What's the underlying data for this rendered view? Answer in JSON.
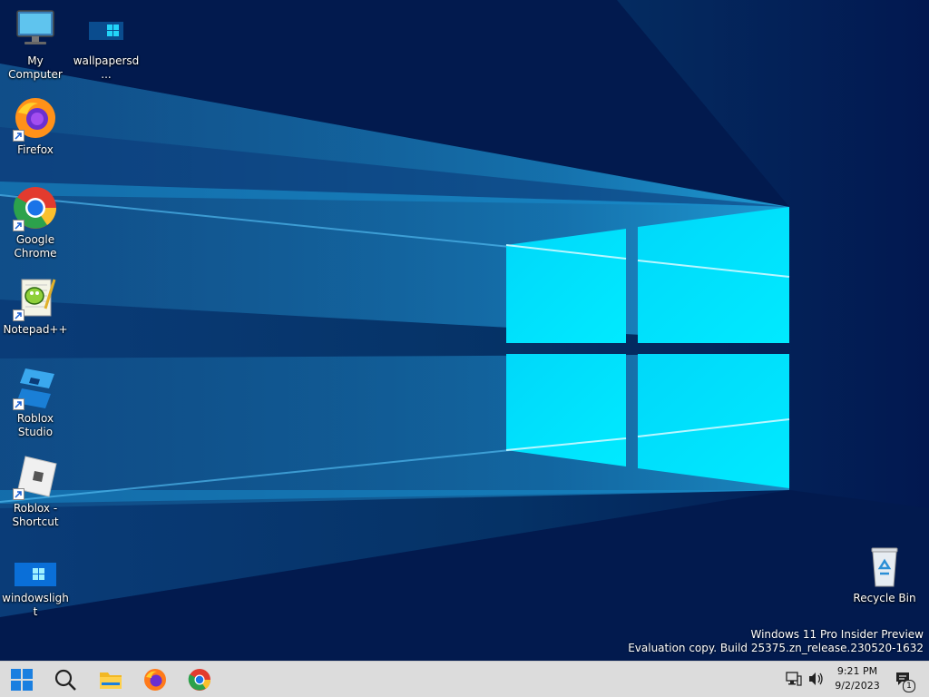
{
  "desktop": {
    "icons": [
      {
        "label": "My Computer",
        "icon": "monitor-icon"
      },
      {
        "label": "wallpapersd...",
        "icon": "image-file-icon"
      },
      {
        "label": "Firefox",
        "icon": "firefox-icon"
      },
      {
        "label": "Google Chrome",
        "icon": "chrome-icon"
      },
      {
        "label": "Notepad++",
        "icon": "notepadpp-icon"
      },
      {
        "label": "Roblox Studio",
        "icon": "roblox-studio-icon"
      },
      {
        "label": "Roblox - Shortcut",
        "icon": "roblox-icon"
      },
      {
        "label": "windowslight",
        "icon": "image-file-icon"
      },
      {
        "label": "Recycle Bin",
        "icon": "recycle-bin-icon"
      }
    ]
  },
  "watermark": {
    "line1": "Windows 11 Pro Insider Preview",
    "line2": "Evaluation copy. Build 25375.zn_release.230520-1632"
  },
  "taskbar": {
    "buttons": [
      "start-icon",
      "search-icon",
      "file-explorer-icon",
      "firefox-icon",
      "chrome-icon"
    ],
    "tray": {
      "time": "9:21 PM",
      "date": "9/2/2023",
      "notification_count": "1"
    }
  },
  "colors": {
    "wallpaper_dark": "#021a4d",
    "wallpaper_light": "#00e4ff",
    "taskbar": "#dcdcdc"
  }
}
